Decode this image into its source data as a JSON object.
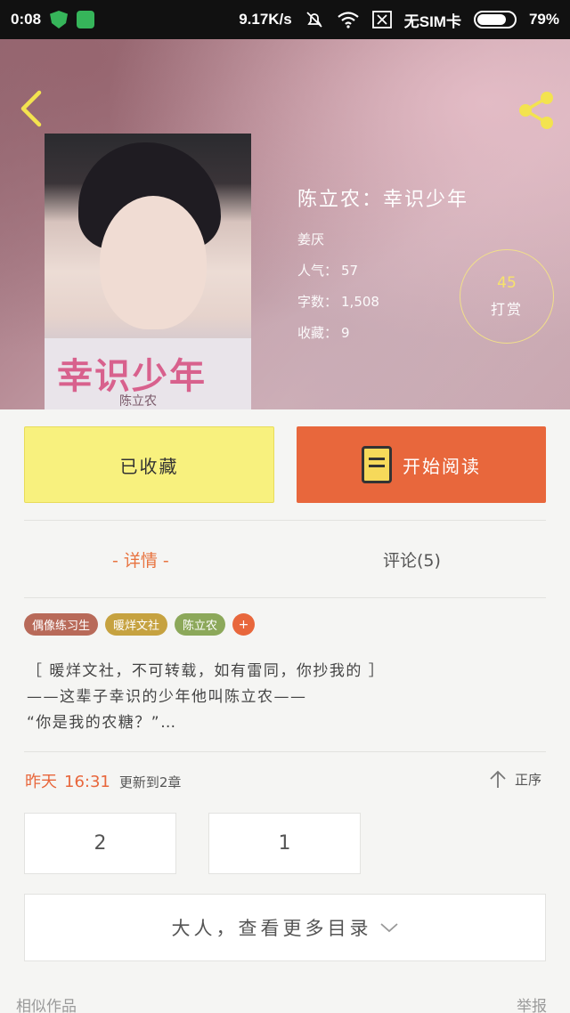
{
  "status_bar": {
    "time": "0:08",
    "speed": "9.17K/s",
    "sim": "无SIM卡",
    "battery": "79%",
    "battery_level": 0.79
  },
  "book": {
    "title": "陈立农：幸识少年",
    "author": "姜厌",
    "popularity_label": "人气：",
    "popularity": "57",
    "words_label": "字数：",
    "words": "1,508",
    "favorites_label": "收藏：",
    "favorites": "9",
    "cover_title": "幸识少年",
    "cover_sub": "陈立农"
  },
  "tip": {
    "count": "45",
    "label": "打赏"
  },
  "actions": {
    "favorite": "已收藏",
    "read": "开始阅读"
  },
  "tabs": {
    "detail": "- 详情 -",
    "comments": "评论(5)"
  },
  "tags": [
    {
      "label": "偶像练习生",
      "color": "#b86a59"
    },
    {
      "label": "暖烊文社",
      "color": "#c6a240"
    },
    {
      "label": "陈立农",
      "color": "#8ca85a"
    }
  ],
  "tag_more": "+",
  "intro": [
    "［ 暖烊文社，不可转载，如有雷同，你抄我的 ］",
    "——这辈子幸识的少年他叫陈立农——",
    "“你是我的农糖？”…"
  ],
  "update": {
    "day": "昨天",
    "time": "16:31",
    "chapter": "更新到2章"
  },
  "sort_label": "正序",
  "chapters": [
    "2",
    "1"
  ],
  "more_catalog": "大人，查看更多目录",
  "footer": {
    "similar": "相似作品",
    "report": "举报"
  },
  "colors": {
    "accent": "#e8673c",
    "favorite_bg": "#f8f17e",
    "tip_text": "#f7e36b"
  }
}
